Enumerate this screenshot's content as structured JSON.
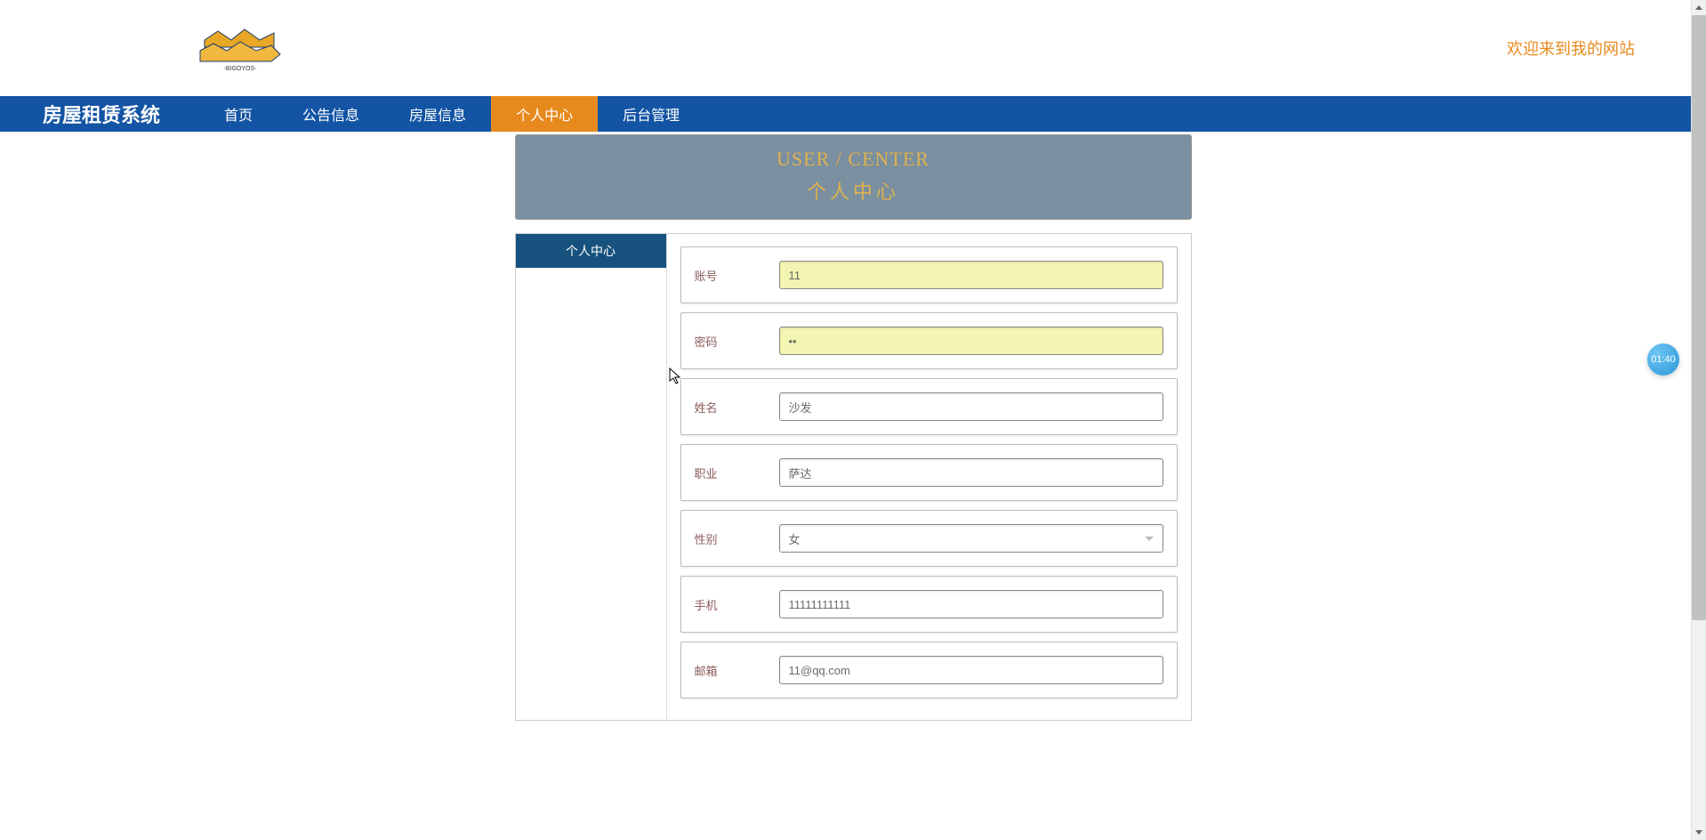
{
  "header": {
    "welcome": "欢迎来到我的网站"
  },
  "nav": {
    "brand": "房屋租赁系统",
    "items": [
      {
        "label": "首页",
        "active": false
      },
      {
        "label": "公告信息",
        "active": false
      },
      {
        "label": "房屋信息",
        "active": false
      },
      {
        "label": "个人中心",
        "active": true
      },
      {
        "label": "后台管理",
        "active": false
      }
    ]
  },
  "banner": {
    "en": "USER / CENTER",
    "cn": "个人中心"
  },
  "sidebar": {
    "items": [
      {
        "label": "个人中心"
      }
    ]
  },
  "form": {
    "account": {
      "label": "账号",
      "value": "11"
    },
    "password": {
      "label": "密码",
      "value": "••"
    },
    "name": {
      "label": "姓名",
      "value": "沙发"
    },
    "occupation": {
      "label": "职业",
      "value": "萨达"
    },
    "gender": {
      "label": "性别",
      "value": "女"
    },
    "phone": {
      "label": "手机",
      "value": "11111111111"
    },
    "email": {
      "label": "邮箱",
      "value": "11@qq.com"
    }
  },
  "badge": {
    "text": "01:40"
  }
}
